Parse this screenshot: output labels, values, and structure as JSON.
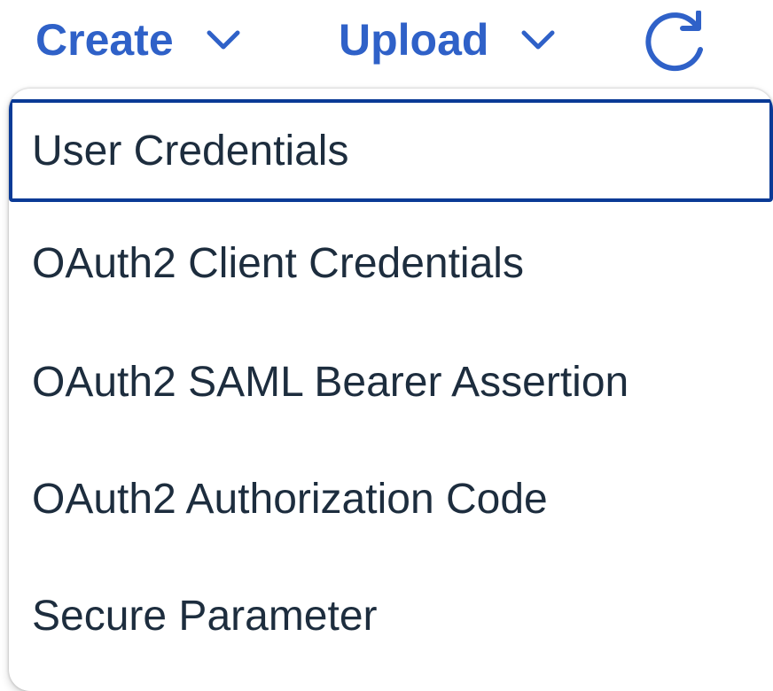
{
  "toolbar": {
    "create_label": "Create",
    "upload_label": "Upload",
    "create_icon": "chevron-down-icon",
    "upload_icon": "chevron-down-icon",
    "refresh_icon": "refresh-icon"
  },
  "menu": {
    "items": [
      {
        "label": "User Credentials",
        "focused": true
      },
      {
        "label": "OAuth2 Client Credentials",
        "focused": false
      },
      {
        "label": "OAuth2 SAML Bearer Assertion",
        "focused": false
      },
      {
        "label": "OAuth2 Authorization Code",
        "focused": false
      },
      {
        "label": "Secure Parameter",
        "focused": false
      }
    ]
  },
  "colors": {
    "accent": "#2f61c8",
    "focus_border": "#0a3a96",
    "menu_text": "#1d2d3e",
    "background": "#ffffff"
  }
}
